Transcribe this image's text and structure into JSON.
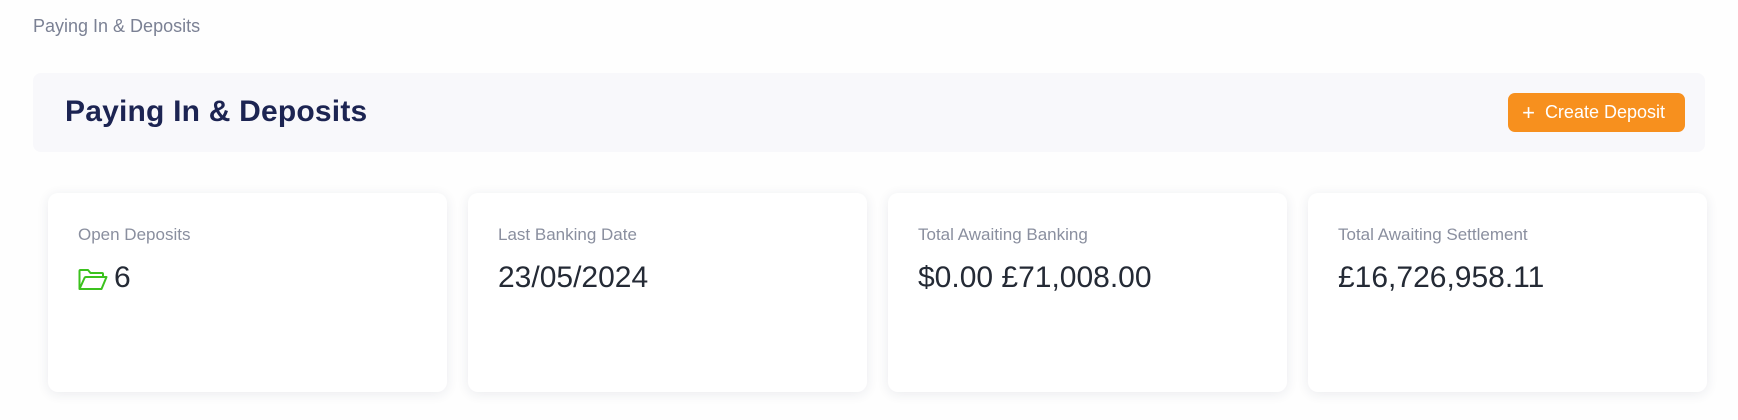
{
  "breadcrumb": "Paying In & Deposits",
  "header": {
    "title": "Paying In & Deposits",
    "create_button": {
      "icon": "plus-icon",
      "label": "Create Deposit"
    }
  },
  "cards": [
    {
      "label": "Open Deposits",
      "icon": "folder-open-icon",
      "value": "6"
    },
    {
      "label": "Last Banking Date",
      "value": "23/05/2024"
    },
    {
      "label": "Total Awaiting Banking",
      "value": "$0.00 £71,008.00"
    },
    {
      "label": "Total Awaiting Settlement",
      "value": "£16,726,958.11"
    }
  ],
  "colors": {
    "accent": "#f7901e",
    "title": "#1c2452",
    "folder_icon": "#3cc21e"
  }
}
